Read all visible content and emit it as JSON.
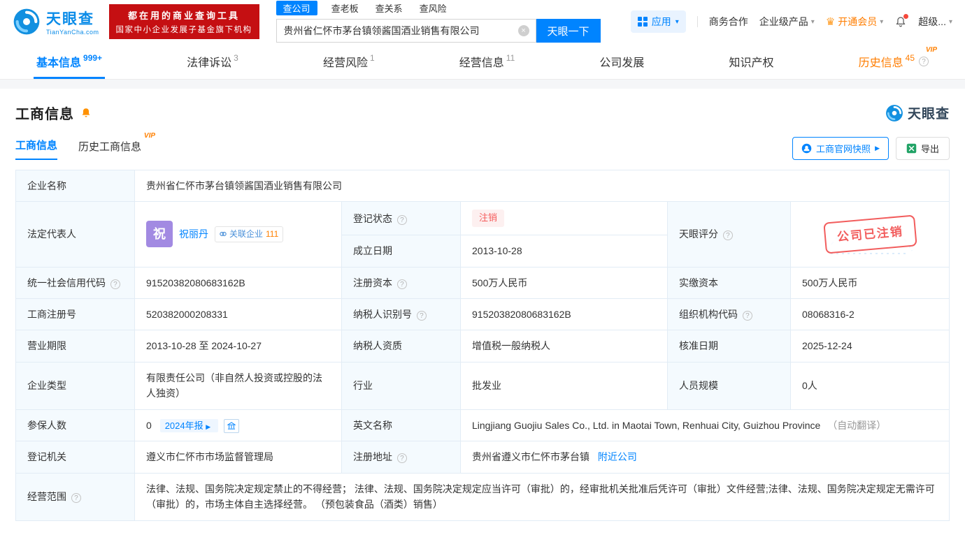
{
  "icons": {
    "caret": "▾",
    "clear": "×",
    "arrow_right": "▶",
    "help": "?",
    "crown": "♛"
  },
  "header": {
    "logo": {
      "title": "天眼查",
      "subtitle": "TianYanCha.com"
    },
    "promo": {
      "line1": "都在用的商业查询工具",
      "line2": "国家中小企业发展子基金旗下机构"
    },
    "search": {
      "tabs": [
        {
          "label": "查公司"
        },
        {
          "label": "查老板"
        },
        {
          "label": "查关系"
        },
        {
          "label": "查风险"
        }
      ],
      "value": "贵州省仁怀市茅台镇领酱国酒业销售有限公司",
      "button": "天眼一下"
    },
    "nav": {
      "app": "应用",
      "items": [
        {
          "label": "商务合作"
        },
        {
          "label": "企业级产品"
        },
        {
          "label": "开通会员"
        },
        {
          "label": "超级..."
        }
      ]
    }
  },
  "nav_tabs": [
    {
      "label": "基本信息",
      "count": "999+"
    },
    {
      "label": "法律诉讼",
      "count": "3"
    },
    {
      "label": "经营风险",
      "count": "1"
    },
    {
      "label": "经营信息",
      "count": "11"
    },
    {
      "label": "公司发展",
      "count": ""
    },
    {
      "label": "知识产权",
      "count": ""
    },
    {
      "label": "历史信息",
      "count": "45",
      "vip": "VIP"
    }
  ],
  "section": {
    "title": "工商信息",
    "watermark": "天眼查",
    "subtabs": [
      {
        "label": "工商信息"
      },
      {
        "label": "历史工商信息",
        "vip": "VIP"
      }
    ],
    "actions": {
      "snapshot": "工商官网快照",
      "export": "导出"
    }
  },
  "table": {
    "company_name": {
      "label": "企业名称",
      "value": "贵州省仁怀市茅台镇领酱国酒业销售有限公司"
    },
    "legal_rep": {
      "label": "法定代表人",
      "avatar": "祝",
      "name": "祝丽丹",
      "related_label": "关联企业",
      "related_count": "111"
    },
    "reg_status": {
      "label": "登记状态",
      "value": "注销"
    },
    "established": {
      "label": "成立日期",
      "value": "2013-10-28"
    },
    "score": {
      "label": "天眼评分",
      "stamp": "公司已注销"
    },
    "credit_code": {
      "label": "统一社会信用代码",
      "value": "91520382080683162B"
    },
    "reg_capital": {
      "label": "注册资本",
      "value": "500万人民币"
    },
    "paid_capital": {
      "label": "实缴资本",
      "value": "500万人民币"
    },
    "reg_number": {
      "label": "工商注册号",
      "value": "520382000208331"
    },
    "taxpayer_id": {
      "label": "纳税人识别号",
      "value": "91520382080683162B"
    },
    "org_code": {
      "label": "组织机构代码",
      "value": "08068316-2"
    },
    "business_term": {
      "label": "营业期限",
      "value": "2013-10-28 至 2024-10-27"
    },
    "taxpayer_quality": {
      "label": "纳税人资质",
      "value": "增值税一般纳税人"
    },
    "approval_date": {
      "label": "核准日期",
      "value": "2025-12-24"
    },
    "company_type": {
      "label": "企业类型",
      "value": "有限责任公司（非自然人投资或控股的法人独资）"
    },
    "industry": {
      "label": "行业",
      "value": "批发业"
    },
    "staff_size": {
      "label": "人员规模",
      "value": "0人"
    },
    "insured": {
      "label": "参保人数",
      "value": "0",
      "report": "2024年报"
    },
    "english_name": {
      "label": "英文名称",
      "value": "Lingjiang Guojiu Sales Co., Ltd. in Maotai Town, Renhuai City, Guizhou Province",
      "note": "（自动翻译）"
    },
    "reg_authority": {
      "label": "登记机关",
      "value": "遵义市仁怀市市场监督管理局"
    },
    "reg_address": {
      "label": "注册地址",
      "value": "贵州省遵义市仁怀市茅台镇",
      "nearby": "附近公司"
    },
    "business_scope": {
      "label": "经营范围",
      "value": "法律、法规、国务院决定规定禁止的不得经营； 法律、法规、国务院决定规定应当许可（审批）的，经审批机关批准后凭许可（审批）文件经营;法律、法规、国务院决定规定无需许可（审批）的，市场主体自主选择经营。 （预包装食品（酒类）销售）"
    }
  }
}
